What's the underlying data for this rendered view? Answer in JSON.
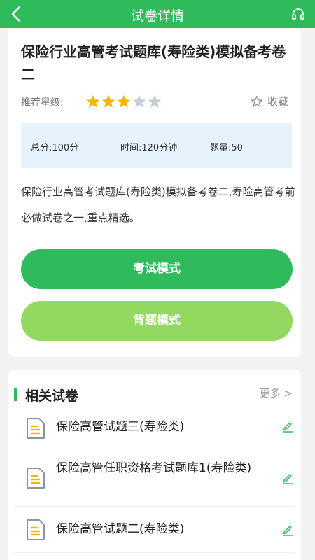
{
  "header": {
    "title": "试卷详情",
    "back_icon": "chevron-left-icon",
    "right_icon": "headphones-icon"
  },
  "paper": {
    "title": "保险行业高管考试题库(寿险类)模拟备考卷二",
    "rating_label": "推荐星级:",
    "rating": 3,
    "rating_max": 5,
    "favorite_label": "收藏",
    "total_score": "总分:100分",
    "duration": "时间:120分钟",
    "question_count": "题量:50",
    "description": "保险行业高管考试题库(寿险类)模拟备考卷二,寿险高管考前必做试卷之一,重点精选。",
    "exam_mode_label": "考试模式",
    "recite_mode_label": "背题模式"
  },
  "related": {
    "title": "相关试卷",
    "more_label": "更多 >",
    "items": [
      {
        "name": "保险高管试题三(寿险类)"
      },
      {
        "name": "保险高管任职资格考试题库1(寿险类)"
      },
      {
        "name": "保险高管试题二(寿险类)"
      }
    ]
  },
  "colors": {
    "primary": "#2fba5c",
    "secondary": "#93d860",
    "star_on": "#f5b400",
    "star_off": "#c5cdd6",
    "info_bg": "#e6f2fc"
  }
}
